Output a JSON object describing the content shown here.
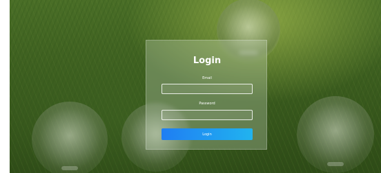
{
  "login_form": {
    "title": "Login",
    "email_label": "Email",
    "email_value": "",
    "password_label": "Password",
    "password_value": "",
    "submit_label": "Login"
  },
  "colors": {
    "button_gradient_start": "#1f7ef3",
    "button_gradient_end": "#21b3ef",
    "text": "#ffffff",
    "background": "#3c5d1f"
  },
  "background_image": "grass field with light bulbs"
}
